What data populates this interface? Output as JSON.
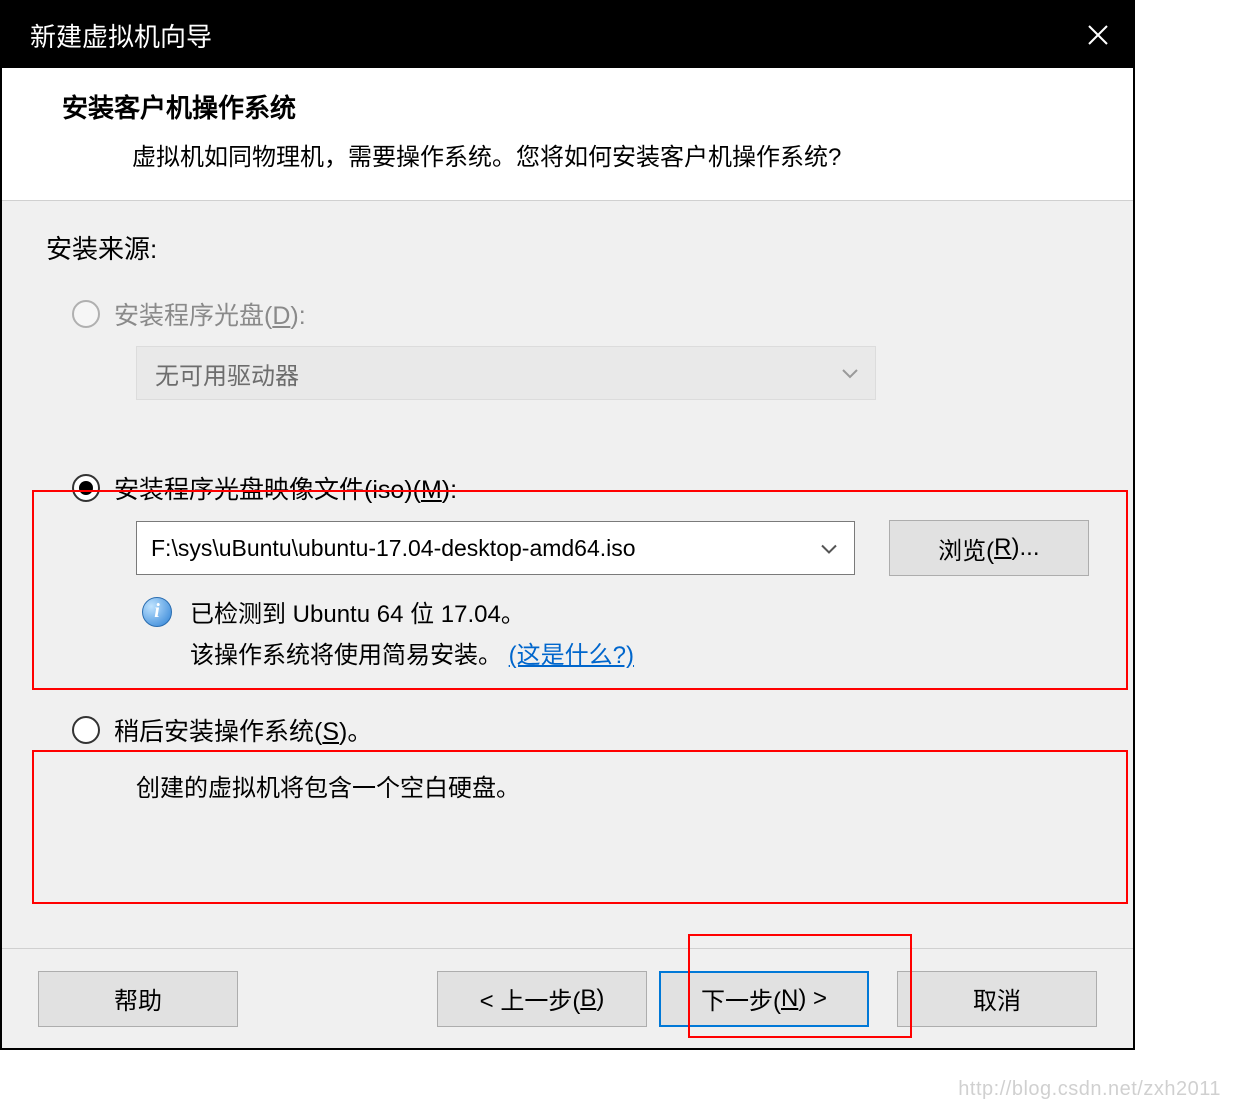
{
  "titlebar": {
    "title": "新建虚拟机向导",
    "close_icon": "close-icon"
  },
  "header": {
    "title": "安装客户机操作系统",
    "subtitle": "虚拟机如同物理机，需要操作系统。您将如何安装客户机操作系统?"
  },
  "section_label": "安装来源:",
  "option_disc": {
    "label_pre": "安装程序光盘(",
    "label_hotkey": "D",
    "label_post": "):",
    "drive_text": "无可用驱动器",
    "enabled": false,
    "selected": false
  },
  "option_iso": {
    "label_pre": "安装程序光盘映像文件(iso)(",
    "label_hotkey": "M",
    "label_post": "):",
    "path": "F:\\sys\\uBuntu\\ubuntu-17.04-desktop-amd64.iso",
    "browse_pre": "浏览(",
    "browse_hotkey": "R",
    "browse_post": ")...",
    "selected": true
  },
  "info": {
    "line1": "已检测到 Ubuntu 64 位 17.04。",
    "line2_pre": "该操作系统将使用简易安装。",
    "link": "(这是什么?)"
  },
  "option_later": {
    "label_pre": "稍后安装操作系统(",
    "label_hotkey": "S",
    "label_post": ")。",
    "desc": "创建的虚拟机将包含一个空白硬盘。",
    "selected": false
  },
  "footer": {
    "help": "帮助",
    "back_pre": "< 上一步(",
    "back_hotkey": "B",
    "back_post": ")",
    "next_pre": "下一步(",
    "next_hotkey": "N",
    "next_post": ") >",
    "cancel": "取消"
  },
  "watermark": "http://blog.csdn.net/zxh2011"
}
